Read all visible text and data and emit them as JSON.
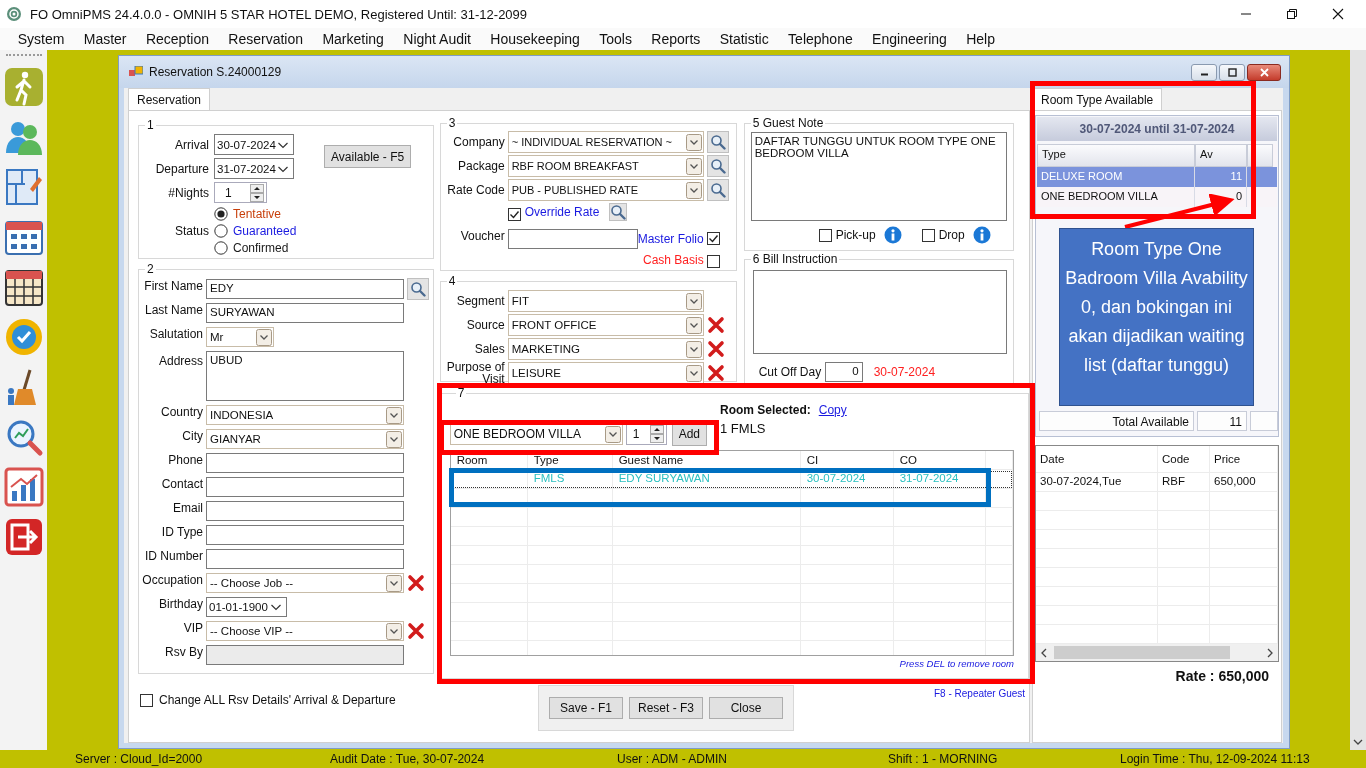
{
  "app": {
    "title": "FO OmniPMS 24.4.0.0 - OMNIH 5 STAR HOTEL DEMO, Registered Until: 31-12-2099"
  },
  "menu": [
    "System",
    "Master",
    "Reception",
    "Reservation",
    "Marketing",
    "Night Audit",
    "Housekeeping",
    "Tools",
    "Reports",
    "Statistic",
    "Telephone",
    "Engineering",
    "Help"
  ],
  "toolbar": [
    {
      "kind": "walk"
    },
    {
      "kind": "people"
    },
    {
      "kind": "plan"
    },
    {
      "kind": "grid"
    },
    {
      "kind": "calendar"
    },
    {
      "kind": "badge"
    },
    {
      "kind": "broom"
    },
    {
      "kind": "magnifier"
    },
    {
      "kind": "chart"
    },
    {
      "kind": "exit"
    }
  ],
  "window": {
    "title": "Reservation S.24000129",
    "tabs": [
      {
        "label": "Reservation",
        "selected": true
      }
    ]
  },
  "stay": {
    "legend": "1",
    "fields": [
      {
        "kind": "date",
        "label": "Arrival",
        "value": "30-07-2024"
      },
      {
        "kind": "date",
        "label": "Departure",
        "value": "31-07-2024"
      },
      {
        "kind": "spin",
        "label": "#Nights",
        "value": "1"
      }
    ],
    "available_button": "Available - F5",
    "status": {
      "label": "Status",
      "options": [
        {
          "label": "Tentative",
          "selected": true,
          "color": "#c8400c"
        },
        {
          "label": "Guaranteed",
          "selected": false,
          "color": "#1a1ae0"
        },
        {
          "label": "Confirmed",
          "selected": false,
          "color": "#1a1a1a"
        }
      ]
    }
  },
  "guest": {
    "legend": "2",
    "fields": [
      {
        "kind": "text",
        "label": "First Name",
        "value": "EDY",
        "lookup": true
      },
      {
        "kind": "text",
        "label": "Last Name",
        "value": "SURYAWAN"
      },
      {
        "kind": "smallcombo",
        "label": "Salutation",
        "value": "Mr"
      },
      {
        "kind": "memo",
        "label": "Address",
        "value": "UBUD"
      },
      {
        "kind": "combo",
        "label": "Country",
        "value": "INDONESIA"
      },
      {
        "kind": "combo",
        "label": "City",
        "value": "GIANYAR"
      },
      {
        "kind": "text",
        "label": "Phone"
      },
      {
        "kind": "text",
        "label": "Contact"
      },
      {
        "kind": "text",
        "label": "Email"
      },
      {
        "kind": "text",
        "label": "ID Type"
      },
      {
        "kind": "text",
        "label": "ID Number"
      },
      {
        "kind": "combo",
        "label": "Occupation",
        "value": "-- Choose Job --",
        "clear": true
      },
      {
        "kind": "date",
        "label": "Birthday",
        "value": "01-01-1900"
      },
      {
        "kind": "combo",
        "label": "VIP",
        "value": "-- Choose VIP --",
        "clear": true
      },
      {
        "kind": "readonly",
        "label": "Rsv By"
      }
    ]
  },
  "rate": {
    "legend": "3",
    "fields": [
      {
        "kind": "combo",
        "label": "Company",
        "value": "~ INDIVIDUAL RESERVATION ~",
        "lookup": true
      },
      {
        "kind": "combo",
        "label": "Package",
        "value": "RBF ROOM BREAKFAST",
        "lookup": true
      },
      {
        "kind": "combo",
        "label": "Rate Code",
        "value": "PUB - PUBLISHED RATE",
        "lookup": true
      }
    ],
    "override": {
      "label": "Override Rate",
      "checked": true
    },
    "voucher": {
      "label": "Voucher"
    },
    "flags": [
      {
        "label": "Master Folio",
        "checked": true,
        "color": "#1a1ae0"
      },
      {
        "label": "Cash Basis",
        "checked": false,
        "color": "#ff2020"
      }
    ]
  },
  "segment": {
    "legend": "4",
    "fields": [
      {
        "kind": "combo",
        "label": "Segment",
        "value": "FIT"
      },
      {
        "kind": "combo",
        "label": "Source",
        "value": "FRONT OFFICE",
        "clear": true
      },
      {
        "kind": "combo",
        "label": "Sales",
        "value": "MARKETING",
        "clear": true
      },
      {
        "kind": "combo",
        "label": "Purpose of Visit",
        "value": "LEISURE",
        "clear": true
      }
    ]
  },
  "guest_note": {
    "legend": "5 Guest Note",
    "text": "DAFTAR TUNGGU UNTUK ROOM TYPE ONE BEDROOM VILLA",
    "options": [
      {
        "label": "Pick-up",
        "checked": false
      },
      {
        "label": "Drop",
        "checked": false
      }
    ]
  },
  "bill_instruction": {
    "legend": "6 Bill Instruction",
    "cut_off": {
      "label": "Cut Off Day",
      "value": "0",
      "date": "30-07-2024"
    }
  },
  "rooms": {
    "legend": "7",
    "room_type": "ONE BEDROOM VILLA",
    "quantity": "1",
    "add_button": "Add",
    "selected_label": "Room Selected:",
    "copy_link": "Copy",
    "selected_summary": "1 FMLS",
    "columns": [
      "Room",
      "Type",
      "Guest Name",
      "CI",
      "CO"
    ],
    "rows": [
      {
        "type": "FMLS",
        "guest_name": "EDY SURYAWAN",
        "ci": "30-07-2024",
        "co": "31-07-2024",
        "selected": true
      }
    ],
    "hint": "Press DEL to remove room"
  },
  "footer": {
    "change_all": {
      "label": "Change ALL Rsv Details' Arrival & Departure",
      "checked": false
    },
    "buttons": [
      "Save - F1",
      "Reset - F3",
      "Close"
    ],
    "repeater_link": "F8 - Repeater Guest"
  },
  "availability": {
    "tabs": [
      {
        "label": "Room Type Available",
        "selected": true
      }
    ],
    "period": "30-07-2024 until 31-07-2024",
    "columns": [
      "Type",
      "Av"
    ],
    "rows": [
      {
        "type": "DELUXE ROOM",
        "av": "11",
        "selected": true
      },
      {
        "type": "ONE BEDROOM VILLA",
        "av": "0",
        "selected": false
      }
    ],
    "total_label": "Total Available",
    "total": "11"
  },
  "rates": {
    "columns": [
      "Date",
      "Code",
      "Price"
    ],
    "rows": [
      {
        "date": "30-07-2024,Tue",
        "code": "RBF",
        "price": "650,000"
      }
    ],
    "total": "Rate : 650,000"
  },
  "status_bar": [
    "Server : Cloud_Id=2000",
    "Audit Date : Tue, 30-07-2024",
    "User : ADM - ADMIN",
    "Shift : 1 - MORNING",
    "Login Time : Thu, 12-09-2024 11:13"
  ],
  "annotations": {
    "frames": [
      {
        "color": "#ff0000"
      },
      {
        "color": "#ff0000"
      },
      {
        "color": "#ff0000"
      },
      {
        "color": "#0070c0"
      }
    ],
    "callout": "Room Type One Badroom Villa Avability 0, dan bokingan ini akan dijadikan waiting list (daftar tunggu)"
  }
}
